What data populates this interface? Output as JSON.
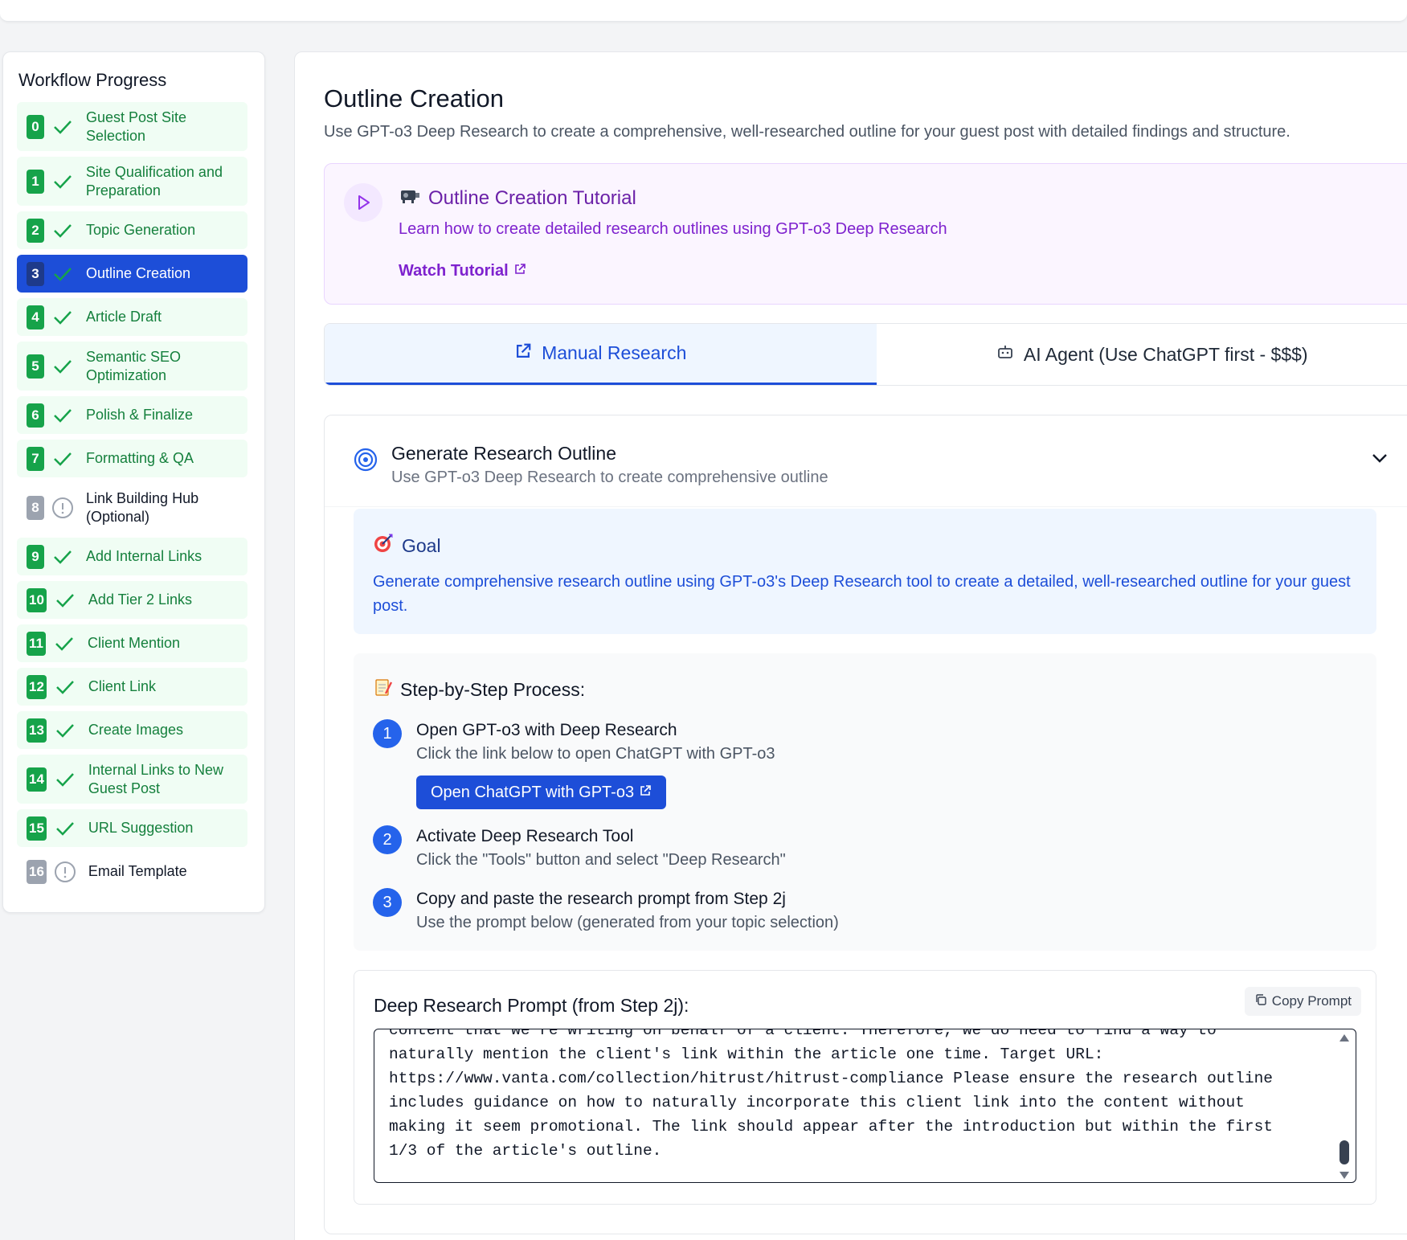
{
  "sidebar": {
    "title": "Workflow Progress",
    "steps": [
      {
        "num": "0",
        "label": "Guest Post Site Selection",
        "status": "done"
      },
      {
        "num": "1",
        "label": "Site Qualification and Preparation",
        "status": "done"
      },
      {
        "num": "2",
        "label": "Topic Generation",
        "status": "done"
      },
      {
        "num": "3",
        "label": "Outline Creation",
        "status": "active"
      },
      {
        "num": "4",
        "label": "Article Draft",
        "status": "done"
      },
      {
        "num": "5",
        "label": "Semantic SEO Optimization",
        "status": "done"
      },
      {
        "num": "6",
        "label": "Polish & Finalize",
        "status": "done"
      },
      {
        "num": "7",
        "label": "Formatting & QA",
        "status": "done"
      },
      {
        "num": "8",
        "label": "Link Building Hub (Optional)",
        "status": "pending"
      },
      {
        "num": "9",
        "label": "Add Internal Links",
        "status": "done"
      },
      {
        "num": "10",
        "label": "Add Tier 2 Links",
        "status": "done"
      },
      {
        "num": "11",
        "label": "Client Mention",
        "status": "done"
      },
      {
        "num": "12",
        "label": "Client Link",
        "status": "done"
      },
      {
        "num": "13",
        "label": "Create Images",
        "status": "done"
      },
      {
        "num": "14",
        "label": "Internal Links to New Guest Post",
        "status": "done"
      },
      {
        "num": "15",
        "label": "URL Suggestion",
        "status": "done"
      },
      {
        "num": "16",
        "label": "Email Template",
        "status": "pending"
      }
    ]
  },
  "main": {
    "title": "Outline Creation",
    "description": "Use GPT-o3 Deep Research to create a comprehensive, well-researched outline for your guest post with detailed findings and structure.",
    "tutorial": {
      "title": "Outline Creation Tutorial",
      "description": "Learn how to create detailed research outlines using GPT-o3 Deep Research",
      "link": "Watch Tutorial"
    },
    "tabs": {
      "manual": "Manual Research",
      "agent": "AI Agent (Use ChatGPT first - $$$)"
    },
    "card": {
      "title": "Generate Research Outline",
      "subtitle": "Use GPT-o3 Deep Research to create comprehensive outline",
      "goal": {
        "title": "Goal",
        "text": "Generate comprehensive research outline using GPT-o3's Deep Research tool to create a detailed, well-researched outline for your guest post."
      },
      "process": {
        "title": "Step-by-Step Process:",
        "steps": [
          {
            "num": "1",
            "title": "Open GPT-o3 with Deep Research",
            "desc": "Click the link below to open ChatGPT with GPT-o3",
            "button": "Open ChatGPT with GPT-o3"
          },
          {
            "num": "2",
            "title": "Activate Deep Research Tool",
            "desc": "Click the \"Tools\" button and select \"Deep Research\""
          },
          {
            "num": "3",
            "title": "Copy and paste the research prompt from Step 2j",
            "desc": "Use the prompt below (generated from your topic selection)"
          }
        ]
      },
      "prompt": {
        "title": "Deep Research Prompt (from Step 2j):",
        "copy_label": "Copy Prompt",
        "text": "content that we're writing on behalf of a client. Therefore, we do need to find a way to naturally mention the client's link within the article one time. Target URL: https://www.vanta.com/collection/hitrust/hitrust-compliance Please ensure the research outline includes guidance on how to naturally incorporate this client link into the content without making it seem promotional. The link should appear after the introduction but within the first 1/3 of the article's outline."
      }
    }
  },
  "colors": {
    "done": "#16a34a",
    "active": "#1d4ed8",
    "pending": "#9ca3af",
    "purple": "#7e22ce"
  }
}
